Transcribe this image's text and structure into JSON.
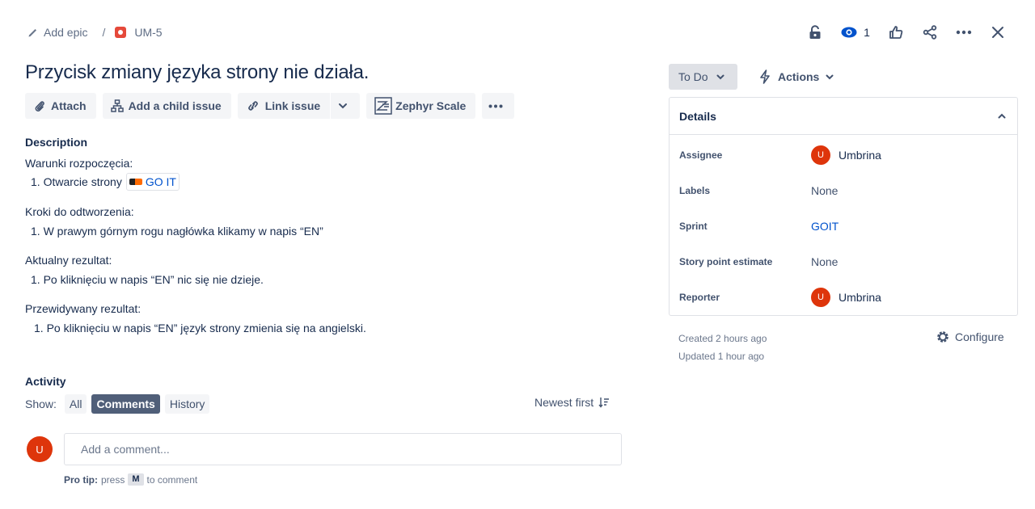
{
  "breadcrumb": {
    "epic_label": "Add epic",
    "separator": "/",
    "issue_key": "UM-5"
  },
  "header_actions": {
    "watch_count": "1"
  },
  "issue": {
    "title": "Przycisk zmiany języka strony nie działa."
  },
  "toolbar": {
    "attach": "Attach",
    "add_child": "Add a child issue",
    "link_issue": "Link issue",
    "zephyr": "Zephyr Scale"
  },
  "description": {
    "heading": "Description",
    "s1_title": "Warunki rozpoczęcia:",
    "s1_item": "1. Otwarcie strony",
    "s1_link": "GO IT",
    "s2_title": "Kroki do odtworzenia:",
    "s2_item": "1. W prawym górnym rogu nagłówka klikamy w napis “EN”",
    "s3_title": "Aktualny rezultat:",
    "s3_item": "1. Po kliknięciu w napis “EN” nic się nie dzieje.",
    "s4_title": "Przewidywany rezultat:",
    "s4_item": "1. Po kliknięciu w napis “EN” język strony zmienia się na angielski."
  },
  "activity": {
    "heading": "Activity",
    "show_label": "Show:",
    "filters": [
      "All",
      "Comments",
      "History"
    ],
    "active_filter": "Comments",
    "sort_label": "Newest first",
    "avatar_initial": "U",
    "comment_placeholder": "Add a comment...",
    "protip_label": "Pro tip:",
    "protip_pre": "press",
    "protip_key": "M",
    "protip_post": "to comment"
  },
  "status": {
    "label": "To Do",
    "actions_label": "Actions"
  },
  "details": {
    "heading": "Details",
    "assignee_label": "Assignee",
    "assignee_initial": "U",
    "assignee_name": "Umbrina",
    "labels_label": "Labels",
    "labels_value": "None",
    "sprint_label": "Sprint",
    "sprint_value": "GOIT",
    "story_label": "Story point estimate",
    "story_value": "None",
    "reporter_label": "Reporter",
    "reporter_initial": "U",
    "reporter_name": "Umbrina"
  },
  "meta": {
    "created": "Created 2 hours ago",
    "updated": "Updated 1 hour ago",
    "configure": "Configure"
  },
  "colors": {
    "accent": "#0052cc",
    "avatar": "#de350b",
    "bug": "#e5493a",
    "status_bg": "#dfe1e6"
  }
}
